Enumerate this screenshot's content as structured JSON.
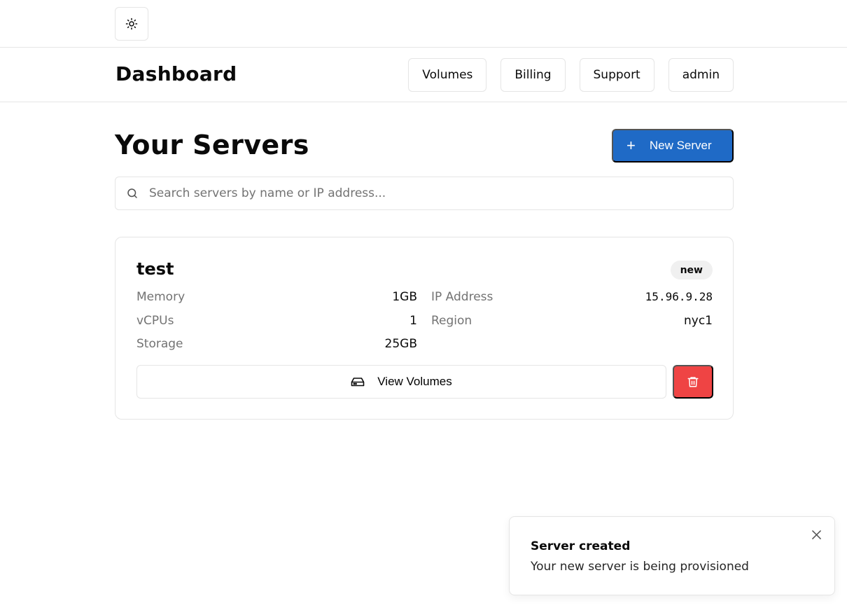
{
  "header": {
    "title": "Dashboard",
    "nav": [
      "Volumes",
      "Billing",
      "Support",
      "admin"
    ]
  },
  "main": {
    "title": "Your Servers",
    "new_server_label": "New Server",
    "search_placeholder": "Search servers by name or IP address..."
  },
  "servers": [
    {
      "name": "test",
      "status": "new",
      "specs": {
        "memory_label": "Memory",
        "memory": "1GB",
        "vcpus_label": "vCPUs",
        "vcpus": "1",
        "storage_label": "Storage",
        "storage": "25GB",
        "ip_label": "IP Address",
        "ip": "15.96.9.28",
        "region_label": "Region",
        "region": "nyc1"
      },
      "view_volumes_label": "View Volumes"
    }
  ],
  "toast": {
    "title": "Server created",
    "description": "Your new server is being provisioned"
  },
  "icons": {
    "theme": "sun-icon",
    "new": "plus-icon",
    "search": "search-icon",
    "volumes": "hard-drive-icon",
    "delete": "trash-icon",
    "close": "close-icon"
  },
  "colors": {
    "primary": "#1f6ac6",
    "danger": "#ef4444",
    "border": "#e5e5e5",
    "muted": "#737373"
  }
}
